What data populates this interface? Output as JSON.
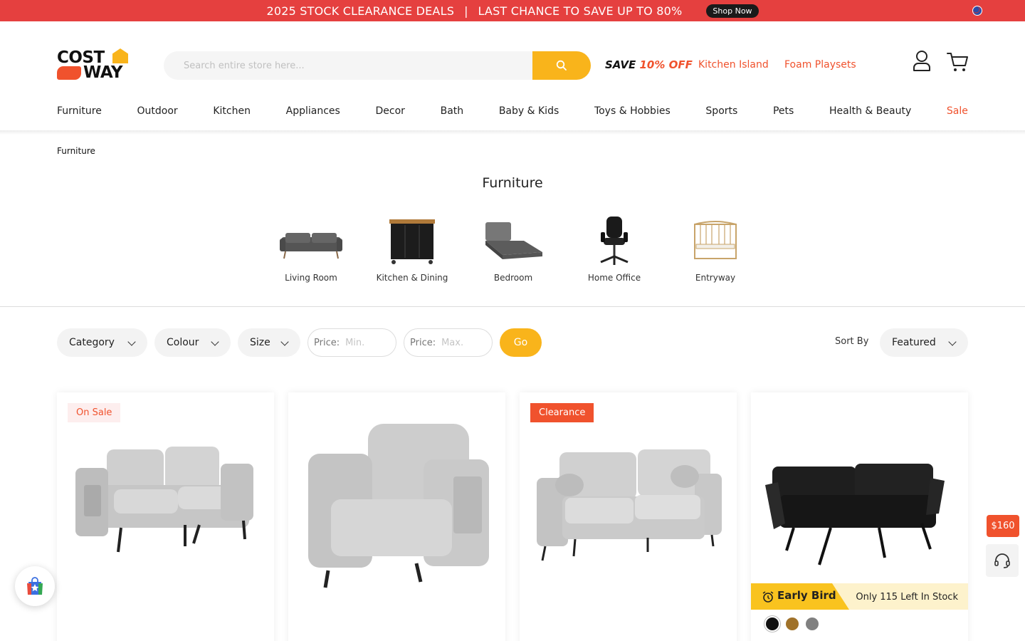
{
  "promo": {
    "text_left": "2025 STOCK CLEARANCE DEALS",
    "separator": "|",
    "text_right": "LAST CHANCE TO SAVE UP TO 80%",
    "button": "Shop Now",
    "flag_icon": "australia-flag-icon"
  },
  "header": {
    "logo_top": "COST",
    "logo_bottom": "WAY",
    "search_placeholder": "Search entire store here...",
    "save_prefix": "SAVE ",
    "save_highlight": "10% OFF",
    "links": [
      "Kitchen Island",
      "Foam Playsets"
    ],
    "account_icon": "user-icon",
    "cart_icon": "cart-icon"
  },
  "nav": {
    "items": [
      "Furniture",
      "Outdoor",
      "Kitchen",
      "Appliances",
      "Decor",
      "Bath",
      "Baby & Kids",
      "Toys & Hobbies",
      "Sports",
      "Pets",
      "Health & Beauty",
      "Sale"
    ]
  },
  "breadcrumb": "Furniture",
  "page_title": "Furniture",
  "subcategories": [
    "Living Room",
    "Kitchen & Dining",
    "Bedroom",
    "Home Office",
    "Entryway"
  ],
  "filters": {
    "category": "Category",
    "colour": "Colour",
    "size": "Size",
    "price_label": "Price:",
    "min_placeholder": "Min.",
    "max_placeholder": "Max.",
    "go": "Go",
    "sort_label": "Sort By",
    "sort_value": "Featured"
  },
  "products": [
    {
      "badge": "On Sale"
    },
    {
      "badge": ""
    },
    {
      "badge": "Clearance"
    },
    {
      "badge": "",
      "promo_title": "Early Bird",
      "stock_text": "Only 115 Left In Stock",
      "swatches": [
        "#111111",
        "#a0722a",
        "#808080"
      ]
    }
  ],
  "floating": {
    "price_tag": "$160",
    "support_icon": "headset-icon",
    "shop_icon": "shopping-bag-icon"
  },
  "colors": {
    "brand_red": "#e5403f",
    "accent_orange": "#f0522d",
    "accent_yellow": "#f9b41b"
  }
}
